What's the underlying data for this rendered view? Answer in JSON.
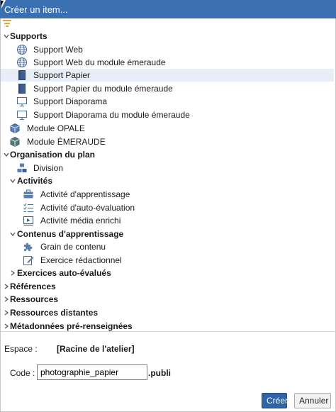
{
  "window": {
    "title": "Créer un item..."
  },
  "tree": {
    "supports": {
      "label": "Supports",
      "items": [
        {
          "label": "Support Web",
          "icon": "globe-icon"
        },
        {
          "label": "Support Web du module émeraude",
          "icon": "globe-icon"
        },
        {
          "label": "Support Papier",
          "icon": "paper-icon",
          "selected": true
        },
        {
          "label": "Support Papier du module émeraude",
          "icon": "paper-icon"
        },
        {
          "label": "Support Diaporama",
          "icon": "slideshow-icon"
        },
        {
          "label": "Support Diaporama du module émeraude",
          "icon": "slideshow-icon"
        }
      ]
    },
    "modules": [
      {
        "label": "Module OPALE",
        "icon": "opale-module-icon"
      },
      {
        "label": "Module ÉMERAUDE",
        "icon": "emeraude-module-icon"
      }
    ],
    "organisation": {
      "label": "Organisation du plan",
      "division": {
        "label": "Division",
        "icon": "division-icon"
      },
      "activites": {
        "label": "Activités",
        "items": [
          {
            "label": "Activité d'apprentissage",
            "icon": "briefcase-icon"
          },
          {
            "label": "Activité d'auto-évaluation",
            "icon": "checklist-icon"
          },
          {
            "label": "Activité média enrichi",
            "icon": "media-icon"
          }
        ]
      },
      "contenus": {
        "label": "Contenus d'apprentissage",
        "items": [
          {
            "label": "Grain de contenu",
            "icon": "puzzle-icon"
          },
          {
            "label": "Exercice rédactionnel",
            "icon": "pencil-edit-icon"
          }
        ]
      },
      "exercices": {
        "label": "Exercices auto-évalués"
      }
    },
    "collapsed_groups": [
      "Références",
      "Ressources",
      "Ressources distantes",
      "Métadonnées pré-renseignées"
    ]
  },
  "form": {
    "espace_label": "Espace :",
    "espace_value": "[Racine de l'atelier]",
    "code_label": "Code :",
    "code_value": "photographie_papier",
    "code_suffix": ".publi"
  },
  "buttons": {
    "create": "Créer",
    "cancel": "Annuler"
  },
  "colors": {
    "titlebar": "#3a6fb0",
    "primary_button": "#2f64a6",
    "selection": "#e8eef7"
  }
}
